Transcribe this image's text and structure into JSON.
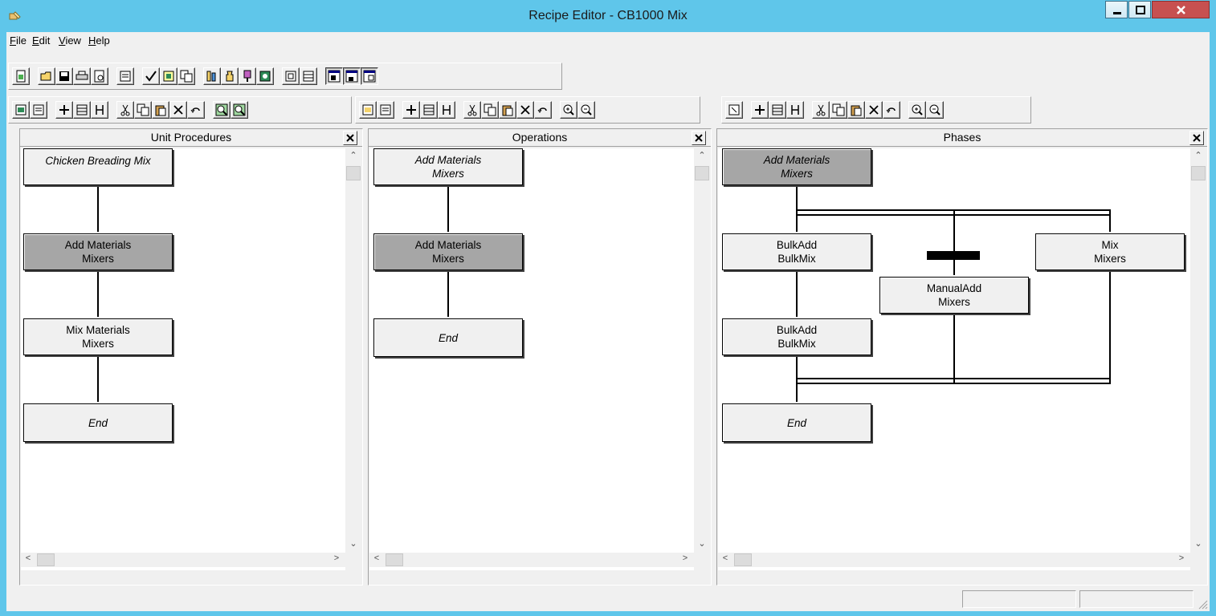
{
  "window": {
    "title": "Recipe Editor - CB1000 Mix"
  },
  "icons": {
    "app": "recipe-editor-icon",
    "minimize": "minimize-icon",
    "maximize": "maximize-icon",
    "close": "close-icon"
  },
  "menu": {
    "file": "File",
    "edit": "Edit",
    "view": "View",
    "help": "Help"
  },
  "panes": {
    "unit_procedures": {
      "title": "Unit Procedures",
      "nodes": [
        {
          "line1": "Chicken Breading Mix",
          "line2": ""
        },
        {
          "line1": "Add Materials",
          "line2": "Mixers"
        },
        {
          "line1": "Mix Materials",
          "line2": "Mixers"
        },
        {
          "line1": "End",
          "line2": ""
        }
      ]
    },
    "operations": {
      "title": "Operations",
      "nodes": [
        {
          "line1": "Add Materials",
          "line2": "Mixers"
        },
        {
          "line1": "Add Materials",
          "line2": "Mixers"
        },
        {
          "line1": "End",
          "line2": ""
        }
      ]
    },
    "phases": {
      "title": "Phases",
      "nodes": [
        {
          "line1": "Add Materials",
          "line2": "Mixers"
        },
        {
          "line1": "BulkAdd",
          "line2": "BulkMix"
        },
        {
          "line1": "ManualAdd",
          "line2": "Mixers"
        },
        {
          "line1": "Mix",
          "line2": "Mixers"
        },
        {
          "line1": "BulkAdd",
          "line2": "BulkMix"
        },
        {
          "line1": "End",
          "line2": ""
        }
      ]
    }
  },
  "colors": {
    "title_bar": "#5fc6ea",
    "selected_node": "#a6a6a6",
    "close_button": "#c75050"
  }
}
